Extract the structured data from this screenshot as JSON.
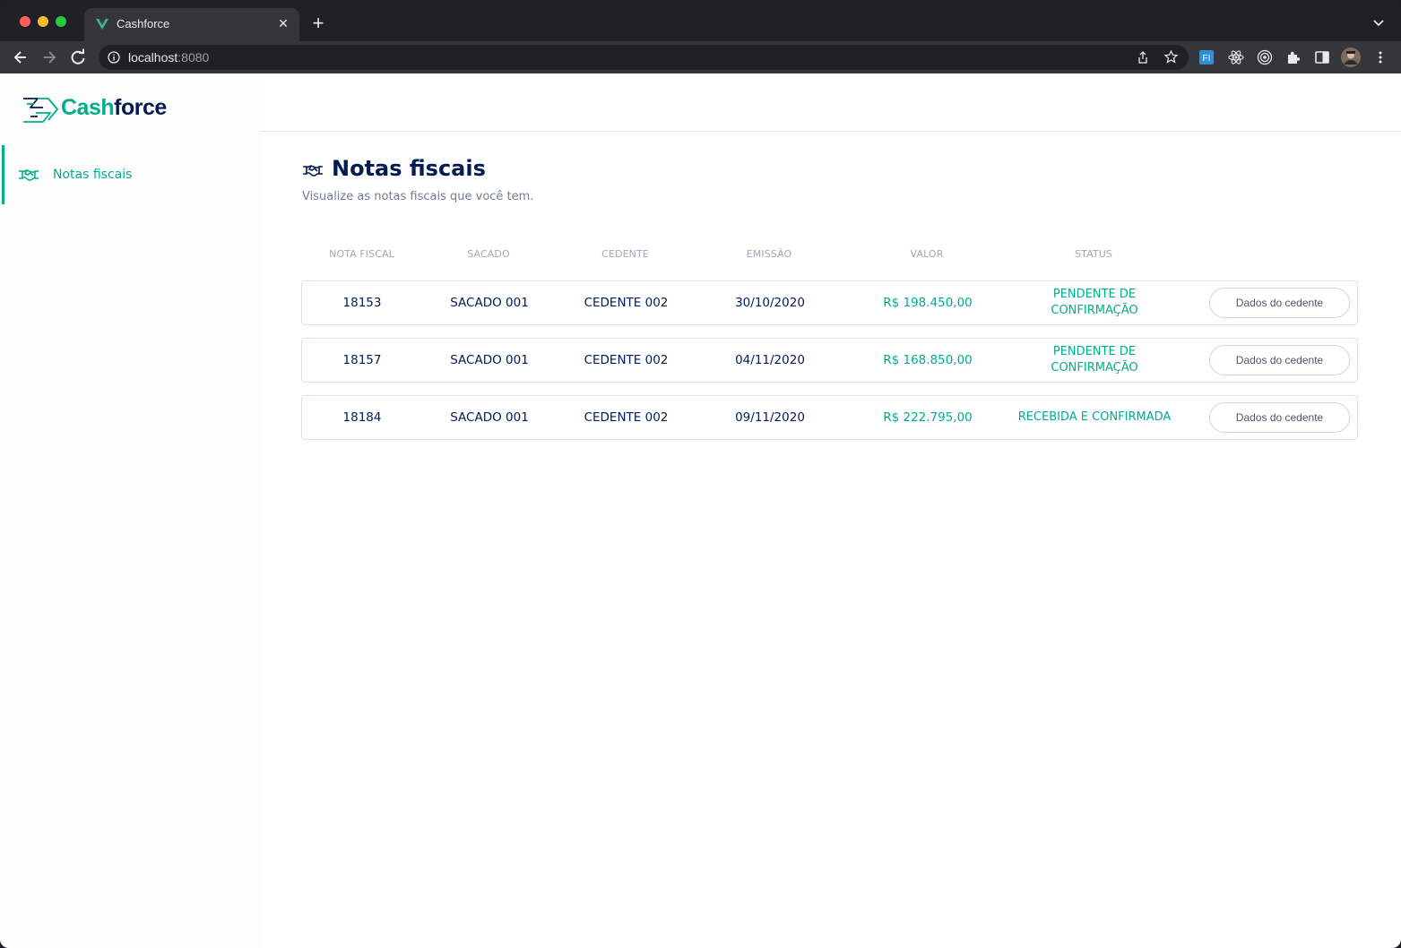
{
  "browser": {
    "tab_title": "Cashforce",
    "url_host": "localhost",
    "url_port": ":8080"
  },
  "sidebar": {
    "logo_part1": "Cash",
    "logo_part2": "force",
    "items": [
      {
        "label": "Notas fiscais",
        "icon": "handshake-icon",
        "active": true
      }
    ]
  },
  "page": {
    "title": "Notas fiscais",
    "subtitle": "Visualize as notas fiscais que você tem."
  },
  "table": {
    "columns": [
      "NOTA FISCAL",
      "SACADO",
      "CEDENTE",
      "EMISSÃO",
      "VALOR",
      "STATUS"
    ],
    "rows": [
      {
        "nota": "18153",
        "sacado": "SACADO 001",
        "cedente": "CEDENTE 002",
        "emissao": "30/10/2020",
        "valor": "R$ 198.450,00",
        "status_l1": "PENDENTE DE",
        "status_l2": "CONFIRMAÇÃO",
        "action": "Dados do cedente"
      },
      {
        "nota": "18157",
        "sacado": "SACADO 001",
        "cedente": "CEDENTE 002",
        "emissao": "04/11/2020",
        "valor": "R$ 168.850,00",
        "status_l1": "PENDENTE DE",
        "status_l2": "CONFIRMAÇÃO",
        "action": "Dados do cedente"
      },
      {
        "nota": "18184",
        "sacado": "SACADO 001",
        "cedente": "CEDENTE 002",
        "emissao": "09/11/2020",
        "valor": "R$ 222.795,00",
        "status_l1": "RECEBIDA E CONFIRMADA",
        "status_l2": "",
        "action": "Dados do cedente"
      }
    ]
  },
  "colors": {
    "accent": "#00ad8c",
    "navy": "#021b51",
    "border": "#dfe2eb"
  }
}
